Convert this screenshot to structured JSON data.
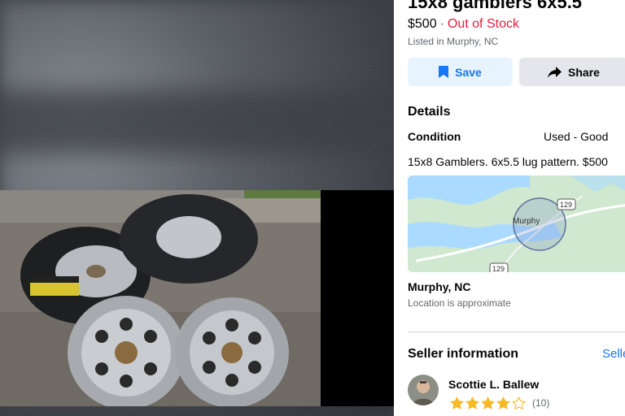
{
  "listing": {
    "title": "15x8 gamblers 6x5.5",
    "price": "$500",
    "separator": "·",
    "stock_status": "Out of Stock",
    "listed_in": "Listed in Murphy, NC"
  },
  "actions": {
    "save_label": "Save",
    "share_label": "Share"
  },
  "details": {
    "heading": "Details",
    "condition_label": "Condition",
    "condition_value": "Used - Good",
    "description": "15x8 Gamblers. 6x5.5 lug pattern. $500"
  },
  "map": {
    "town_label": "Murphy",
    "shield_top": "129",
    "shield_bottom": "129"
  },
  "location": {
    "title": "Murphy, NC",
    "subtitle": "Location is approximate"
  },
  "seller": {
    "heading": "Seller information",
    "details_link": "Seller details",
    "name": "Scottie L. Ballew",
    "rating": 4,
    "rating_count": "(10)"
  },
  "colors": {
    "accent": "#1877f2",
    "out_of_stock": "#e41e3f",
    "star": "#f7b928"
  },
  "icons": {
    "save": "bookmark-icon",
    "share": "share-arrow-icon",
    "star": "star-icon"
  }
}
